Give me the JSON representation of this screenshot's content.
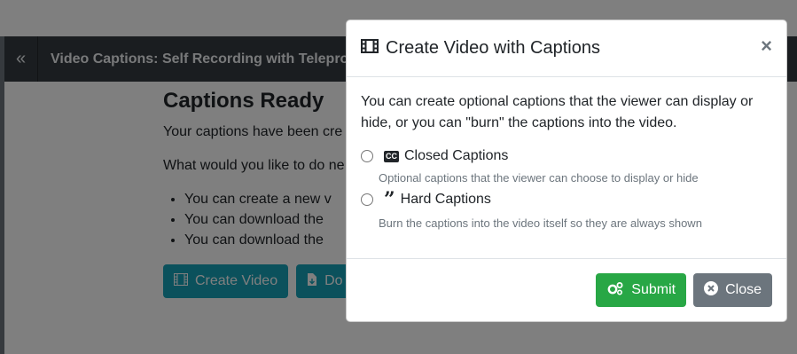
{
  "background": {
    "header_title": "Video Captions: Self Recording with Telepron",
    "heading": "Captions Ready",
    "para1": "Your captions have been cre",
    "para2": "What would you like to do ne",
    "list": [
      "You can create a new v",
      "You can download the",
      "You can download the"
    ],
    "create_video_label": "Create Video",
    "download_label": "Do"
  },
  "modal": {
    "title": "Create Video with Captions",
    "intro": "You can create optional captions that the viewer can display or hide, or you can \"burn\" the captions into the video.",
    "options": [
      {
        "label": "Closed Captions",
        "help": "Optional captions that the viewer can choose to display or hide",
        "icon": "closed-captions-icon",
        "icon_text": "CC"
      },
      {
        "label": "Hard Captions",
        "help": "Burn the captions into the video itself so they are always shown",
        "icon": "quote-icon"
      }
    ],
    "submit_label": "Submit",
    "close_label": "Close"
  },
  "colors": {
    "submit": "#28a745",
    "close": "#6c757d",
    "header_bg": "#343a40",
    "teal": "#17a2b8"
  }
}
